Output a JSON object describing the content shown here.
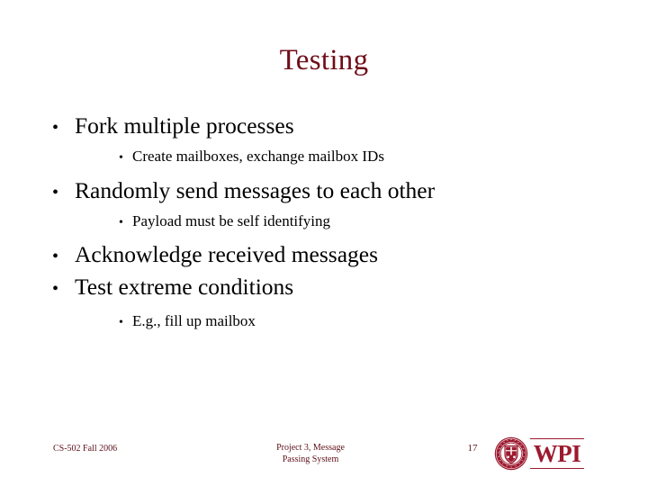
{
  "slide": {
    "title": "Testing",
    "title_color": "#6e0d18",
    "background_color": "#ffffff",
    "body_text_color": "#000000"
  },
  "content": {
    "bullets": [
      {
        "level": 1,
        "text": "Fork multiple processes",
        "marker": "•"
      },
      {
        "level": 2,
        "text": "Create mailboxes, exchange mailbox IDs",
        "marker": "•"
      },
      {
        "level": 1,
        "text": "Randomly send messages to each other",
        "marker": "•"
      },
      {
        "level": 2,
        "text": "Payload must be self identifying",
        "marker": "•"
      },
      {
        "level": 1,
        "text": "Acknowledge received messages",
        "marker": "•"
      },
      {
        "level": 1,
        "text": "Test extreme conditions",
        "marker": "•"
      },
      {
        "level": 2,
        "text": "E.g., fill up mailbox",
        "marker": "•"
      }
    ]
  },
  "footer": {
    "course": "CS-502 Fall 2006",
    "project_line1": "Project 3, Message",
    "project_line2": "Passing System",
    "slide_number": "17",
    "footer_color": "#5c1018"
  },
  "logo": {
    "letters": "WPI",
    "seal_name": "wpi-seal-icon",
    "brand_color": "#9c1a2f"
  }
}
